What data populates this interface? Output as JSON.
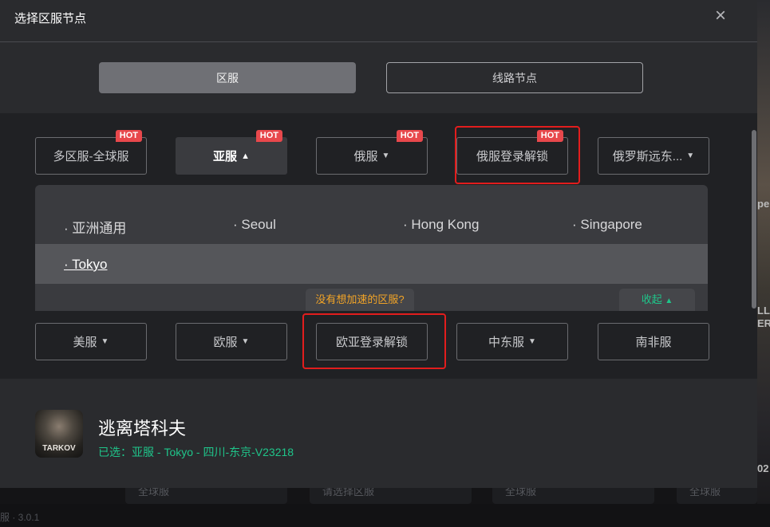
{
  "dialog": {
    "title": "选择区服节点",
    "close_icon": "×"
  },
  "tabs": [
    {
      "label": "区服",
      "active": true
    },
    {
      "label": "线路节点",
      "active": false
    }
  ],
  "regions_row1": [
    {
      "label": "多区服-全球服",
      "hot": "HOT"
    },
    {
      "label": "亚服",
      "hot": "HOT",
      "chevron": "^"
    },
    {
      "label": "俄服",
      "hot": "HOT",
      "chevron": "v"
    },
    {
      "label": "俄服登录解锁",
      "hot": "HOT"
    },
    {
      "label": "俄罗斯远东...",
      "chevron": "v"
    }
  ],
  "subregions": [
    {
      "label": "· 亚洲通用"
    },
    {
      "label": "· Seoul"
    },
    {
      "label": "· Hong Kong"
    },
    {
      "label": "· Singapore"
    },
    {
      "label": "· Tokyo"
    }
  ],
  "tip": "没有想加速的区服?",
  "collapse_label": "收起",
  "regions_row2": [
    {
      "label": "美服",
      "chevron": "v"
    },
    {
      "label": "欧服",
      "chevron": "v"
    },
    {
      "label": "欧亚登录解锁"
    },
    {
      "label": "中东服",
      "chevron": "v"
    },
    {
      "label": "南非服"
    }
  ],
  "game": {
    "icon_text": "TARKOV",
    "title": "逃离塔科夫",
    "selection": "已选：亚服 - Tokyo - 四川-东京-V23218"
  },
  "background": {
    "edge_texts": [
      "pe",
      "LL",
      "ER",
      "02"
    ],
    "card_labels": [
      "全球服",
      "请选择区服",
      "全球服",
      "全球服"
    ],
    "bottom_text": "服 · 3.0.1"
  },
  "colors": {
    "accent_green": "#1fc58a",
    "hot_red": "#e8484c",
    "highlight_red": "#e21d1d",
    "tip_orange": "#f2a427"
  }
}
